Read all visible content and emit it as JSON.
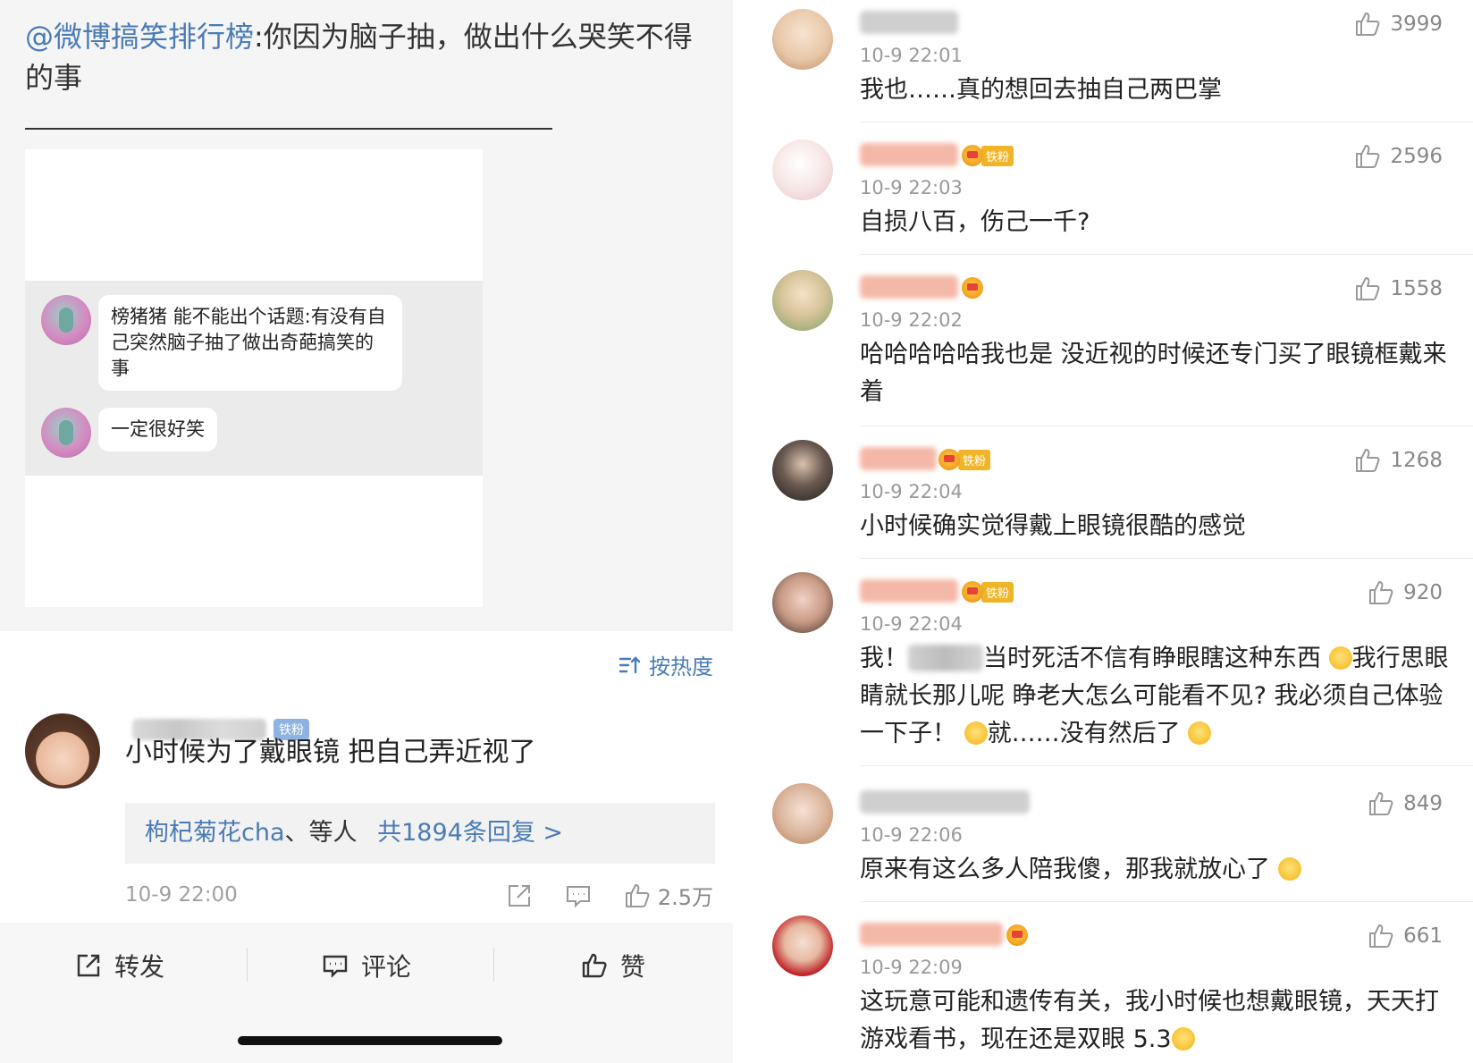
{
  "post": {
    "mention": "@微博搞笑排行榜",
    "title_rest": ":你因为脑子抽，做出什么哭笑不得的事"
  },
  "chat": {
    "messages": [
      {
        "text": "榜猪猪 能不能出个话题:有没有自己突然脑子抽了做出奇葩搞笑的事"
      },
      {
        "text": "一定很好笑"
      }
    ]
  },
  "comments_section": {
    "sort_label": "按热度",
    "top_comment": {
      "fan_tag": "铁粉",
      "text": "小时候为了戴眼镜 把自己弄近视了",
      "reply_names": "枸杞菊花cha",
      "reply_mid": "、等人",
      "reply_count_text": "共1894条回复 >",
      "time": "10-9 22:00",
      "likes": "2.5万",
      "icons": [
        "share-icon",
        "comment-icon",
        "like-icon"
      ]
    }
  },
  "bottom_bar": {
    "repost": "转发",
    "comment": "评论",
    "like": "赞"
  },
  "replies": [
    {
      "time": "10-9 22:01",
      "likes": "3999",
      "text": "我也……真的想回去抽自己两巴掌",
      "badge": "",
      "avatar_color": "#e8c7a8"
    },
    {
      "time": "10-9 22:03",
      "likes": "2596",
      "text": "自损八百，伤己一千?",
      "badge": "铁粉",
      "avatar_color": "#f3e6e6"
    },
    {
      "time": "10-9 22:02",
      "likes": "1558",
      "text": "哈哈哈哈哈我也是 没近视的时候还专门买了眼镜框戴来着",
      "badge": "",
      "avatar_color": "#b9c98f"
    },
    {
      "time": "10-9 22:04",
      "likes": "1268",
      "text": "小时候确实觉得戴上眼镜很酷的感觉",
      "badge": "铁粉",
      "avatar_color": "#2b2b2b"
    },
    {
      "time": "10-9 22:04",
      "likes": "920",
      "text_a": "我！",
      "text_b": "当时死活不信有睁眼瞎这种东西",
      "text_c": "我行思眼睛就长那儿呢 睁老大怎么可能看不见? 我必须自己体验一下子！",
      "text_d": "就……没有然后了",
      "badge": "铁粉",
      "avatar_color": "#c89a86"
    },
    {
      "time": "10-9 22:06",
      "likes": "849",
      "text": "原来有这么多人陪我傻，那我就放心了",
      "badge": "",
      "avatar_color": "#d9b39a"
    },
    {
      "time": "10-9 22:09",
      "likes": "661",
      "text": "这玩意可能和遗传有关，我小时候也想戴眼镜，天天打游戏看书，现在还是双眼 5.3",
      "badge": "",
      "avatar_color": "#c0262b"
    }
  ]
}
